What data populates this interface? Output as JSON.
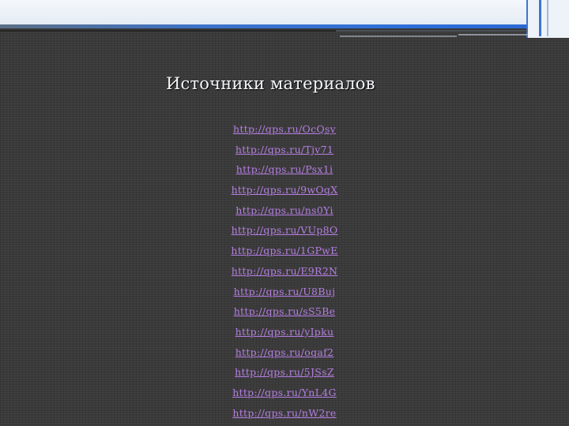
{
  "slide": {
    "title": "Источники материалов",
    "links": [
      "http://qps.ru/OcQsy",
      "http://qps.ru/Tjv71",
      "http://qps.ru/Psx1i",
      "http://qps.ru/9wOqX",
      "http://qps.ru/ns0Yi",
      "http://qps.ru/VUp8O",
      "http://qps.ru/1GPwE",
      "http://qps.ru/E9R2N",
      "http://qps.ru/U8Buj",
      "http://qps.ru/sS5Be",
      "http://qps.ru/yIpku",
      "http://qps.ru/oqaf2",
      "http://qps.ru/5JSsZ",
      "http://qps.ru/YnL4G",
      "http://qps.ru/nW2re"
    ]
  },
  "colors": {
    "background": "#3a3a3a",
    "accent": "#2f6fd8",
    "link": "#b57ee2",
    "title": "#f3f5f8"
  }
}
